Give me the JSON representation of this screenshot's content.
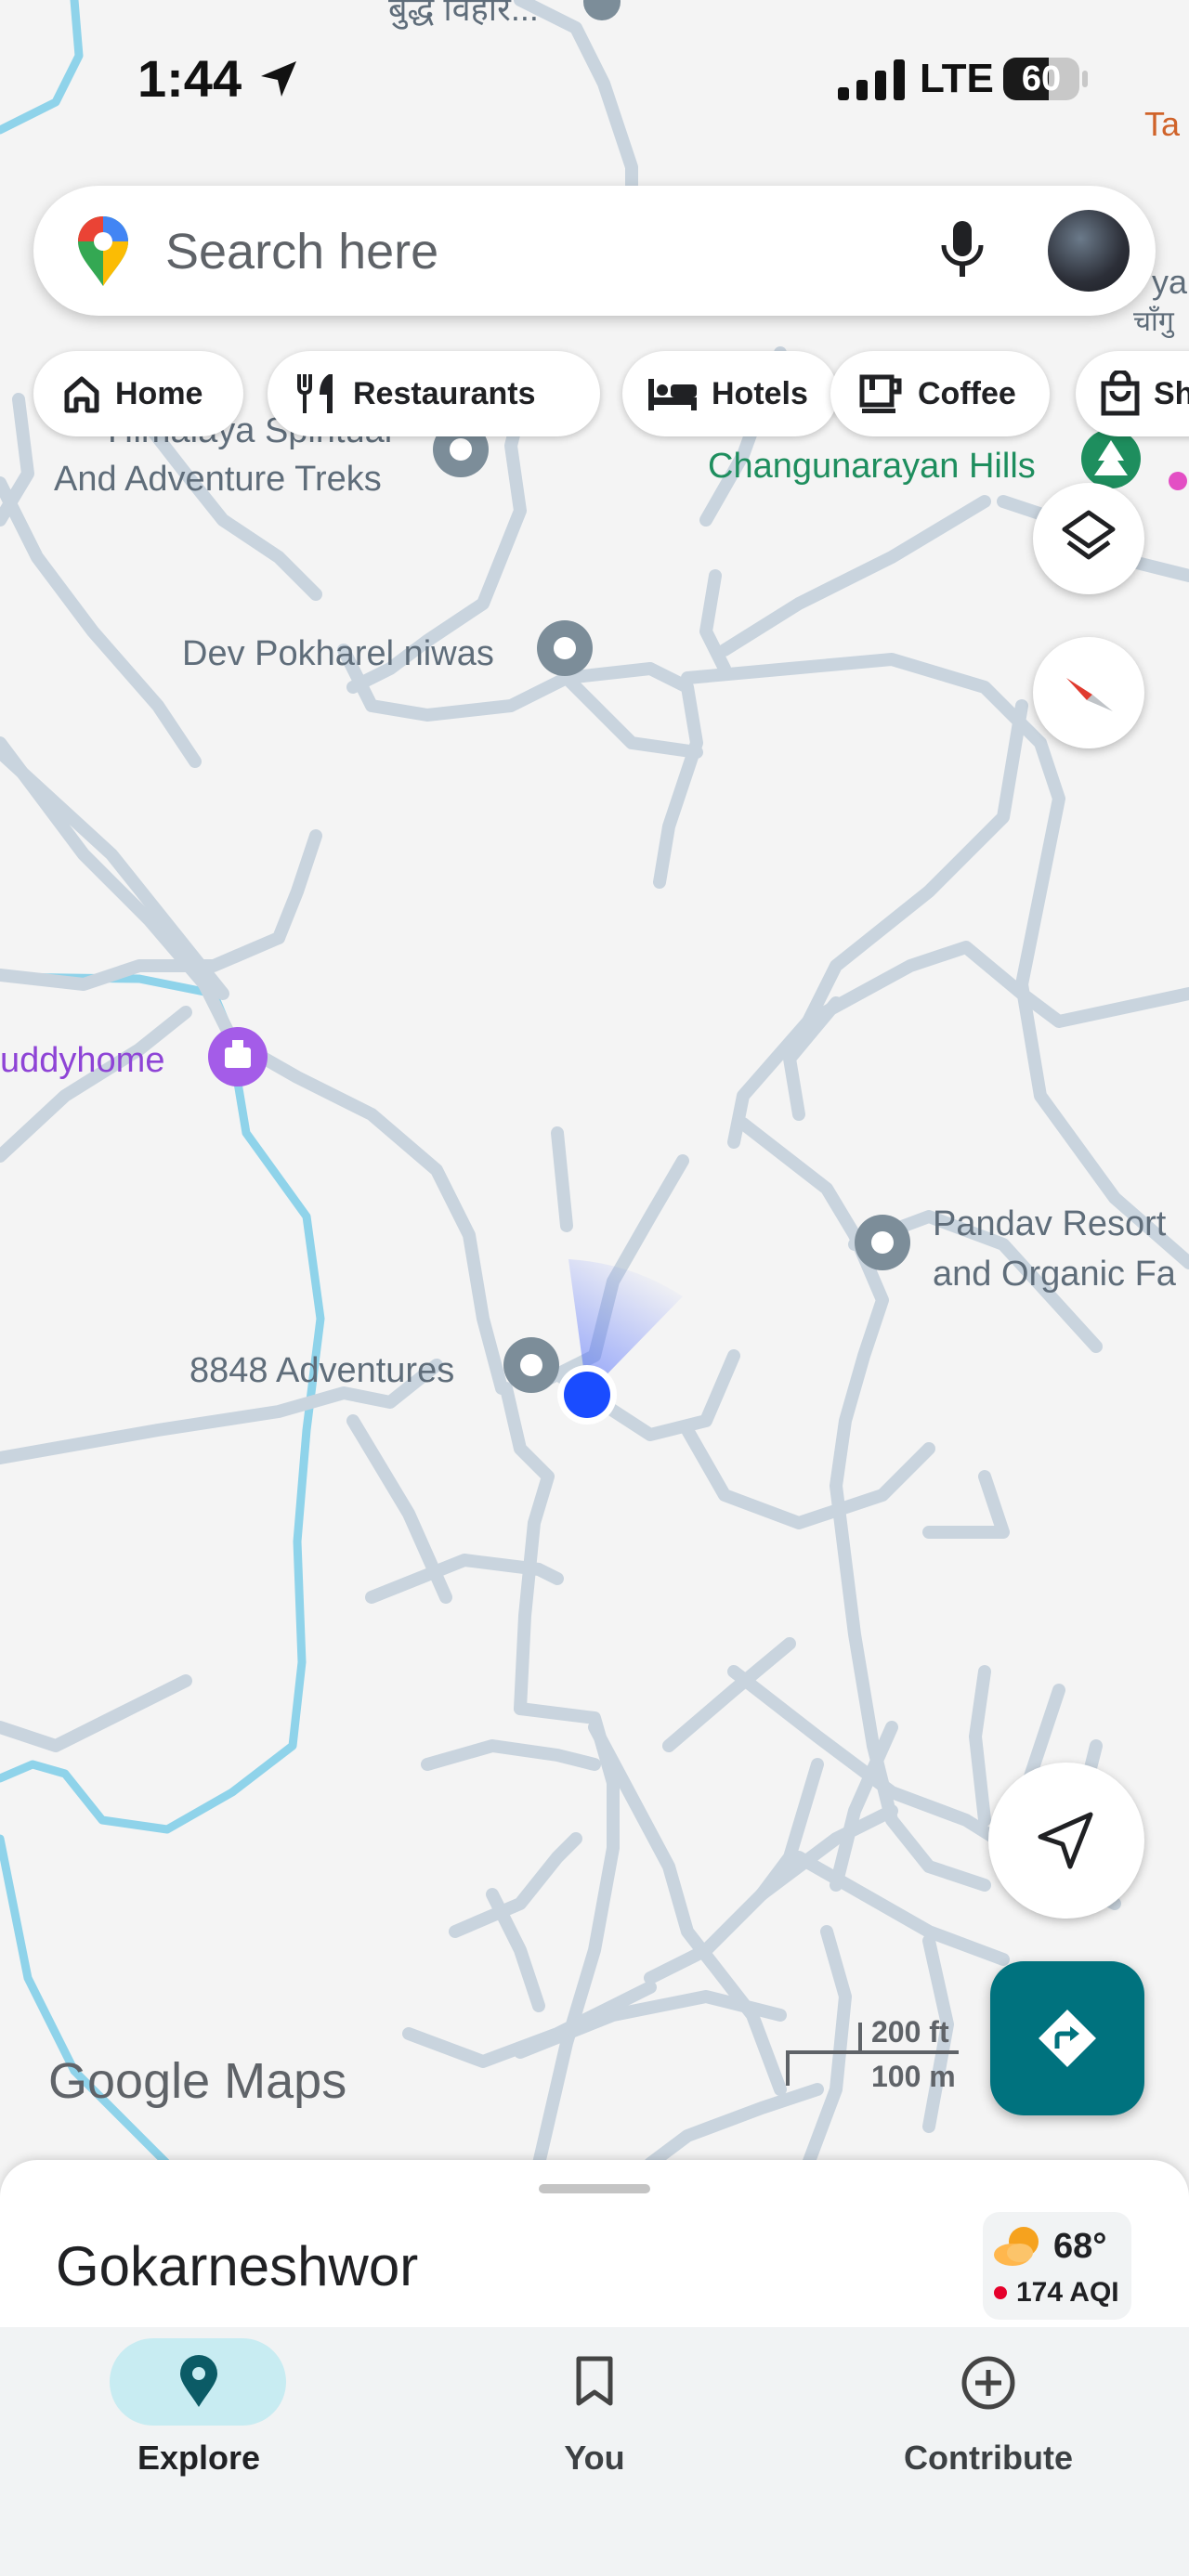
{
  "status_bar": {
    "time": "1:44",
    "network": "LTE",
    "battery": "60",
    "battery_level": 0.6
  },
  "search": {
    "placeholder": "Search here"
  },
  "chips": [
    {
      "label": "Home",
      "icon": "home-icon"
    },
    {
      "label": "Restaurants",
      "icon": "fork-knife-icon"
    },
    {
      "label": "Hotels",
      "icon": "bed-icon"
    },
    {
      "label": "Coffee",
      "icon": "coffee-cup-icon"
    },
    {
      "label": "Sh",
      "icon": "shopping-bag-icon"
    }
  ],
  "map": {
    "labels": {
      "top_devanagari": "बुद्ध विहार...",
      "top_right_orange": "Ta",
      "right_devanagari_1": "ya",
      "right_devanagari_2": "चाँगु",
      "himalaya_1": "Himalaya Spiritual",
      "himalaya_2": "And Adventure Treks",
      "changunarayan": "Changunarayan Hills",
      "dev_pokharel": "Dev Pokharel niwas",
      "buddyhome": "uddyhome",
      "pandav_1": "Pandav Resort",
      "pandav_2": "and Organic Fa",
      "adventures": "8848 Adventures"
    },
    "wordmark_google": "Google",
    "wordmark_maps": "Maps",
    "scale_ft": "200 ft",
    "scale_m": "100 m"
  },
  "controls": {
    "layers_icon": "layers-icon",
    "compass_icon": "compass-icon",
    "my_location_icon": "navigation-arrow-icon",
    "directions_icon": "directions-icon"
  },
  "sheet": {
    "place": "Gokarneshwor",
    "temperature": "68°",
    "aqi": "174 AQI"
  },
  "nav": [
    {
      "label": "Explore",
      "icon": "map-pin-icon",
      "active": true
    },
    {
      "label": "You",
      "icon": "bookmark-icon",
      "active": false
    },
    {
      "label": "Contribute",
      "icon": "add-circle-icon",
      "active": false
    }
  ],
  "colors": {
    "accent_teal": "#00727e",
    "explore_pill": "#c8ecf2",
    "road": "#c9d4de",
    "water": "#8fd3ea",
    "park_green": "#1e8e5e",
    "poi_purple": "#8e44d6",
    "location_blue": "#1a4cff"
  }
}
